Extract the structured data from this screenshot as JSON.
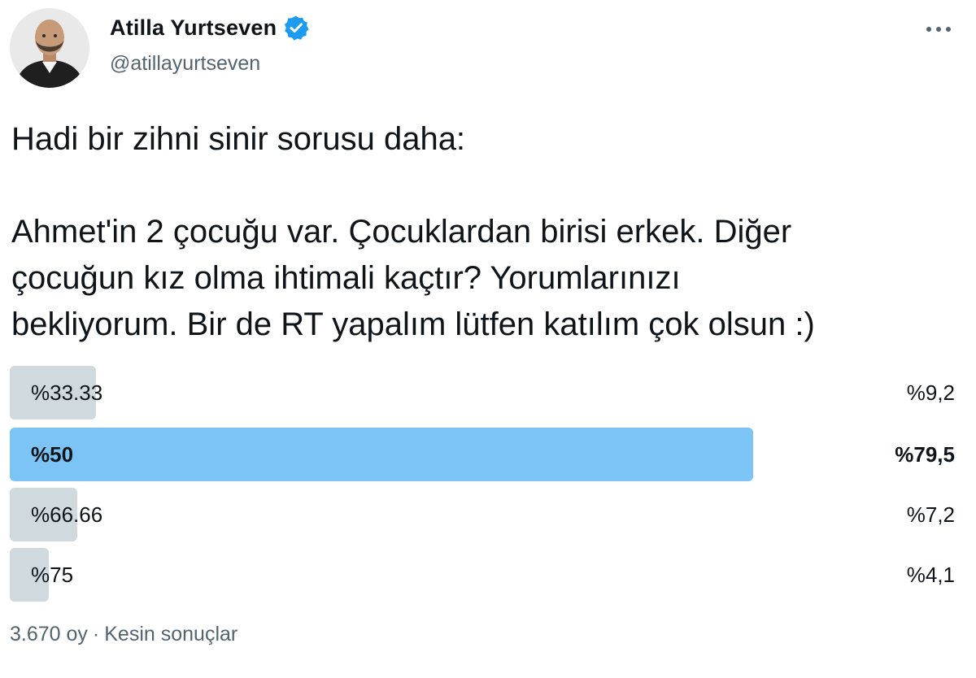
{
  "author": {
    "display_name": "Atilla Yurtseven",
    "handle": "@atillayurtseven",
    "verified": true,
    "avatar_icon": "avatar-photo-icon",
    "verified_icon": "verified-badge-icon",
    "more_icon": "more-options-icon"
  },
  "tweet": {
    "lines": [
      "Hadi bir zihni sinir sorusu daha:",
      "Ahmet'in 2 çocuğu var. Çocuklardan birisi erkek. Diğer",
      "çocuğun kız olma ihtimali kaçtır? Yorumlarınızı",
      "bekliyorum. Bir de RT yapalım lütfen katılım çok olsun :)"
    ]
  },
  "poll": {
    "options": [
      {
        "label": "%33.33",
        "percent_text": "%9,2",
        "share": 0.092,
        "winner": false
      },
      {
        "label": "%50",
        "percent_text": "%79,5",
        "share": 0.795,
        "winner": true
      },
      {
        "label": "%66.66",
        "percent_text": "%7,2",
        "share": 0.072,
        "winner": false
      },
      {
        "label": "%75",
        "percent_text": "%4,1",
        "share": 0.041,
        "winner": false
      }
    ],
    "votes": "3.670 oy",
    "separator": "·",
    "status": "Kesin sonuçlar"
  },
  "colors": {
    "winner_bar": "#7cc4f6",
    "other_bar": "#cfd9de",
    "verified": "#1d9bf0",
    "secondary_text": "#536471"
  }
}
